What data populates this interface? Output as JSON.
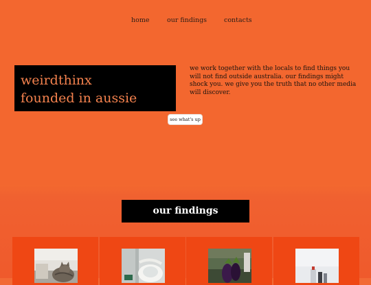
{
  "nav": {
    "items": [
      {
        "label": "home"
      },
      {
        "label": "our findings"
      },
      {
        "label": "contacts"
      }
    ]
  },
  "hero": {
    "title_line1": "weirdthinx",
    "title_line2": "founded in aussie",
    "description": "we work together with the locals to find things you will not find outside australia. our findings might shock you. we give you the truth that no other media will discover.",
    "cta_label": "see what's up"
  },
  "findings": {
    "heading": "our findings",
    "cards": [
      {
        "image": "cat-photo"
      },
      {
        "image": "toilet-photo"
      },
      {
        "image": "eggplant-photo"
      },
      {
        "image": "bottle-photo"
      }
    ]
  },
  "colors": {
    "background": "#f3672f",
    "accent_text": "#f4824e",
    "card": "#ef4714"
  }
}
